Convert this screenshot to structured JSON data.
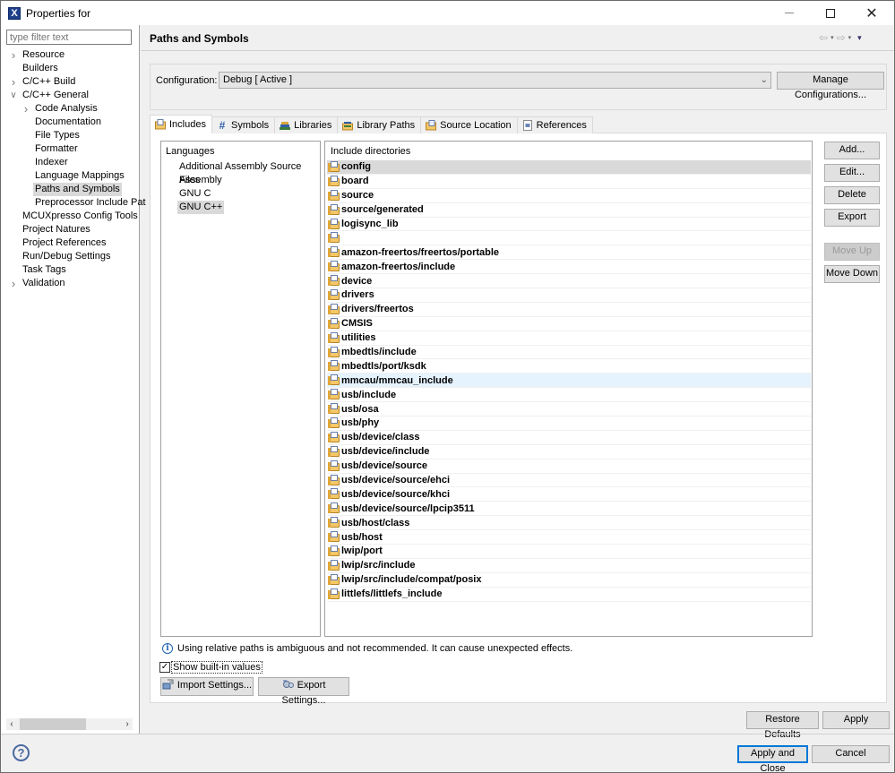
{
  "window": {
    "title": "Properties for",
    "app_icon": "X",
    "controls": {
      "minimize": "minimize-icon",
      "maximize": "maximize-icon",
      "close": "close-icon",
      "close_glyph": "✕"
    }
  },
  "sidebar": {
    "filter_placeholder": "type filter text",
    "items": [
      {
        "label": "Resource",
        "level": 0,
        "expander": "collapsed"
      },
      {
        "label": "Builders",
        "level": 0,
        "expander": "none"
      },
      {
        "label": "C/C++ Build",
        "level": 0,
        "expander": "collapsed"
      },
      {
        "label": "C/C++ General",
        "level": 0,
        "expander": "expanded"
      },
      {
        "label": "Code Analysis",
        "level": 1,
        "expander": "collapsed"
      },
      {
        "label": "Documentation",
        "level": 1,
        "expander": "none"
      },
      {
        "label": "File Types",
        "level": 1,
        "expander": "none"
      },
      {
        "label": "Formatter",
        "level": 1,
        "expander": "none"
      },
      {
        "label": "Indexer",
        "level": 1,
        "expander": "none"
      },
      {
        "label": "Language Mappings",
        "level": 1,
        "expander": "none"
      },
      {
        "label": "Paths and Symbols",
        "level": 1,
        "expander": "none",
        "selected": true
      },
      {
        "label": "Preprocessor Include Pat",
        "level": 1,
        "expander": "none"
      },
      {
        "label": "MCUXpresso Config Tools",
        "level": 0,
        "expander": "none"
      },
      {
        "label": "Project Natures",
        "level": 0,
        "expander": "none"
      },
      {
        "label": "Project References",
        "level": 0,
        "expander": "none"
      },
      {
        "label": "Run/Debug Settings",
        "level": 0,
        "expander": "none"
      },
      {
        "label": "Task Tags",
        "level": 0,
        "expander": "none"
      },
      {
        "label": "Validation",
        "level": 0,
        "expander": "collapsed"
      }
    ],
    "scroll_left": "‹",
    "scroll_right": "›"
  },
  "header": {
    "title": "Paths and Symbols",
    "back_glyph": "⇦",
    "forward_glyph": "⇨",
    "dropdown_glyph": "▾"
  },
  "configuration": {
    "label": "Configuration:",
    "value": "Debug  [ Active ]",
    "manage_button": "Manage Configurations..."
  },
  "tabs": [
    {
      "label": "Includes",
      "icon": "includes-icon",
      "active": true
    },
    {
      "label": "Symbols",
      "icon": "hash-icon",
      "glyph": "#"
    },
    {
      "label": "Libraries",
      "icon": "libraries-icon"
    },
    {
      "label": "Library Paths",
      "icon": "library-paths-icon"
    },
    {
      "label": "Source Location",
      "icon": "source-location-icon"
    },
    {
      "label": "References",
      "icon": "references-icon"
    }
  ],
  "languages": {
    "header": "Languages",
    "items": [
      "Additional Assembly Source Files",
      "Assembly",
      "GNU C",
      "GNU C++"
    ],
    "selected": "GNU C++"
  },
  "include_directories": {
    "header": "Include directories",
    "selected": "config",
    "hovered": "mmcau/mmcau_include",
    "items": [
      "config",
      "board",
      "source",
      "source/generated",
      "logisync_lib",
      "",
      "amazon-freertos/freertos/portable",
      "amazon-freertos/include",
      "device",
      "drivers",
      "drivers/freertos",
      "CMSIS",
      "utilities",
      "mbedtls/include",
      "mbedtls/port/ksdk",
      "mmcau/mmcau_include",
      "usb/include",
      "usb/osa",
      "usb/phy",
      "usb/device/class",
      "usb/device/include",
      "usb/device/source",
      "usb/device/source/ehci",
      "usb/device/source/khci",
      "usb/device/source/lpcip3511",
      "usb/host/class",
      "usb/host",
      "lwip/port",
      "lwip/src/include",
      "lwip/src/include/compat/posix",
      "littlefs/littlefs_include"
    ]
  },
  "side_buttons": {
    "add": "Add...",
    "edit": "Edit...",
    "delete": "Delete",
    "export": "Export",
    "move_up": "Move Up",
    "move_down": "Move Down"
  },
  "info": {
    "icon_glyph": "i",
    "message": "Using relative paths is ambiguous and not recommended. It can cause unexpected effects."
  },
  "show_builtin": {
    "label": "Show built-in values",
    "checked": true,
    "check_glyph": "✓"
  },
  "settings_buttons": {
    "import": "Import Settings...",
    "export": "Export Settings..."
  },
  "footer": {
    "restore_defaults": "Restore Defaults",
    "apply": "Apply",
    "apply_and_close": "Apply and Close",
    "cancel": "Cancel",
    "help_glyph": "?"
  },
  "colors": {
    "accent": "#0078d7",
    "selection": "#d9d9d9",
    "hover": "#e5f3ff",
    "folder": "#f4c767"
  }
}
